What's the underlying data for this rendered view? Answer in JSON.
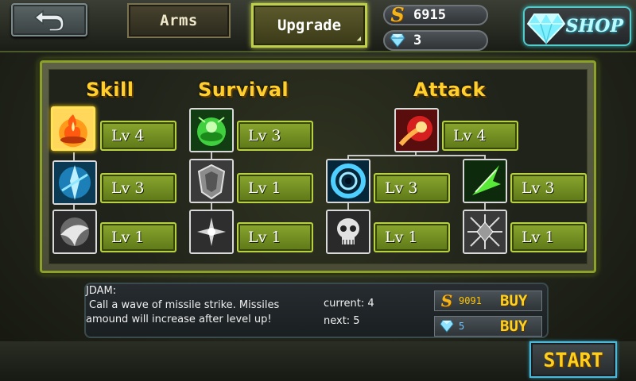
{
  "header": {
    "arms_label": "Arms",
    "upgrade_label": "Upgrade",
    "gold": "6915",
    "gems": "3",
    "shop_label": "SHOP"
  },
  "columns": {
    "skill": "Skill",
    "survival": "Survival",
    "attack": "Attack"
  },
  "skills": [
    {
      "id": "skill-fire",
      "level": "Lv 4",
      "selected": true
    },
    {
      "id": "skill-blue-blade",
      "level": "Lv 3"
    },
    {
      "id": "skill-white-burst",
      "level": "Lv 1"
    },
    {
      "id": "survival-green-orb",
      "level": "Lv 3"
    },
    {
      "id": "survival-shield",
      "level": "Lv 1"
    },
    {
      "id": "survival-spark",
      "level": "Lv 1"
    },
    {
      "id": "attack-fireball",
      "level": "Lv 4"
    },
    {
      "id": "attack-vortex",
      "level": "Lv 3"
    },
    {
      "id": "attack-green-slash",
      "level": "Lv 3"
    },
    {
      "id": "attack-skull",
      "level": "Lv 1"
    },
    {
      "id": "attack-shatter",
      "level": "Lv 1"
    }
  ],
  "info": {
    "name": "JDAM:",
    "line1": "Call a wave of missile strike. Missiles",
    "line2": "amound will increase after level up!",
    "current": "current: 4",
    "next": "next: 5"
  },
  "buy": {
    "gold_price": "9091",
    "gem_price": "5",
    "buy_label": "BUY"
  },
  "start_label": "START"
}
